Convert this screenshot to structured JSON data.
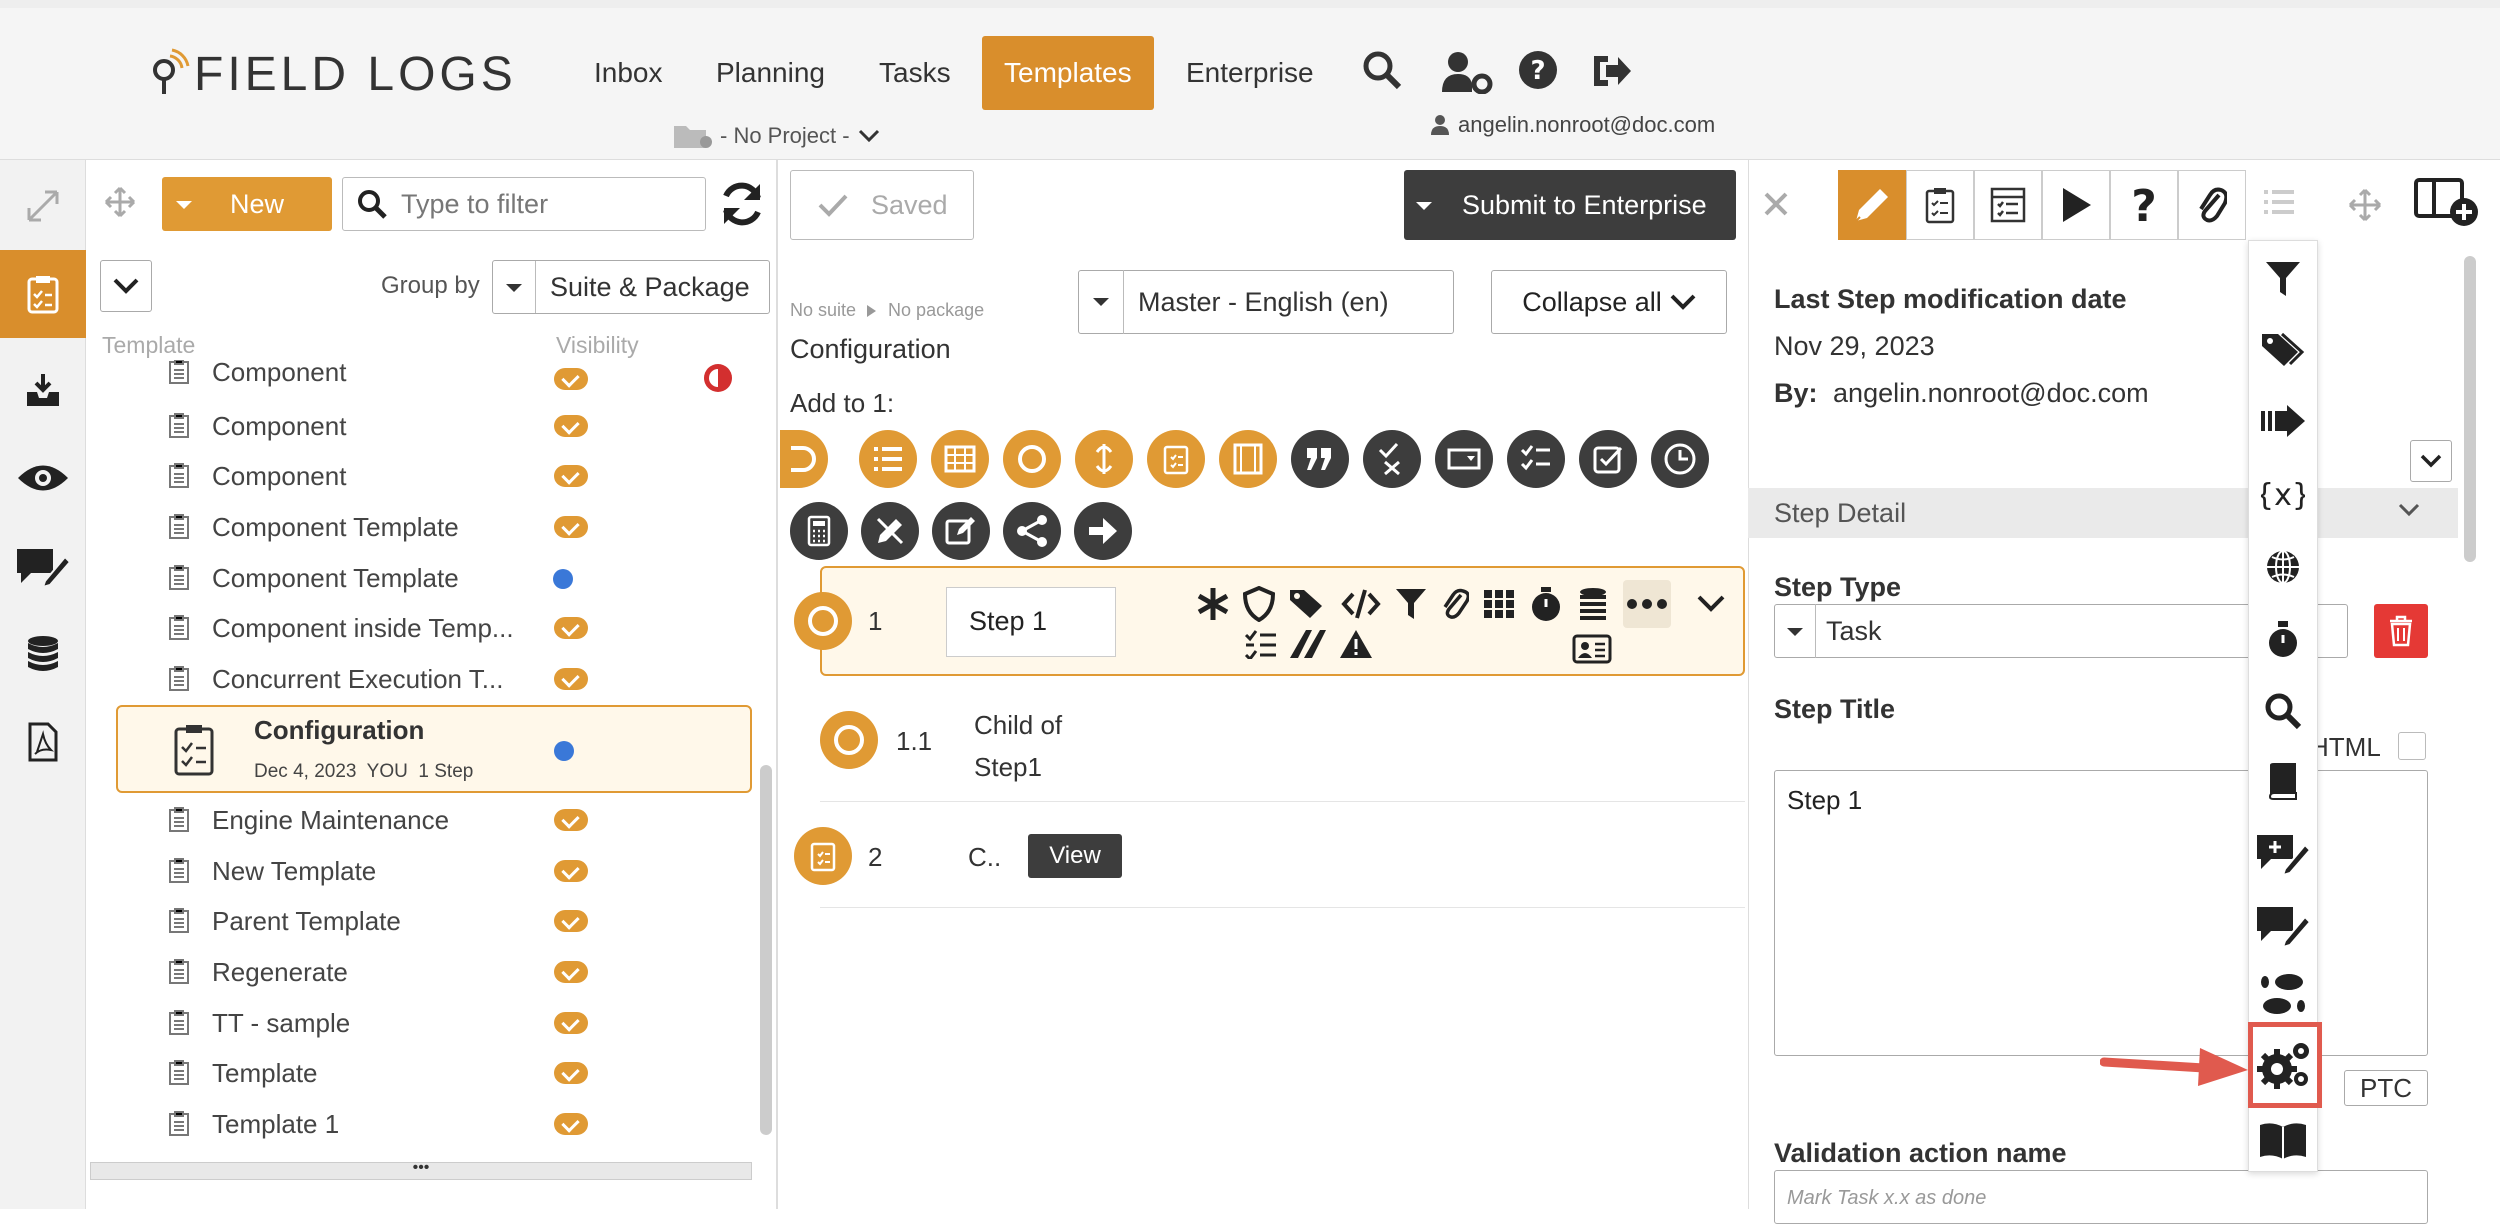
{
  "app": {
    "logo": "FIELD LOGS",
    "user": "angelin.nonroot@doc.com",
    "project": "- No Project -"
  },
  "nav": [
    "Inbox",
    "Planning",
    "Tasks",
    "Templates",
    "Enterprise"
  ],
  "toolbar": {
    "new": "New",
    "filter_placeholder": "Type to filter",
    "saved": "Saved",
    "submit": "Submit to Enterprise"
  },
  "list": {
    "group_by": "Group by",
    "group_value": "Suite & Package",
    "col_template": "Template",
    "col_visibility": "Visibility",
    "items": [
      "Component",
      "Component",
      "Component",
      "Component Template",
      "Component Template",
      "Component inside Temp...",
      "Concurrent Execution T..."
    ],
    "selected": {
      "title": "Configuration",
      "meta": "Dec 4, 2023  YOU  1 Step"
    },
    "items2": [
      "Engine Maintenance",
      "New Template",
      "Parent Template",
      "Regenerate",
      "TT - sample",
      "Template",
      "Template 1"
    ]
  },
  "editor": {
    "breadcrumb_suite": "No suite",
    "breadcrumb_pkg": "No package",
    "name": "Configuration",
    "lang": "Master - English (en)",
    "collapse": "Collapse all",
    "add_to": "Add to 1:",
    "steps": [
      {
        "num": "1",
        "title": "Step 1"
      },
      {
        "num": "1.1",
        "title_a": "Child of",
        "title_b": "Step1"
      },
      {
        "num": "2",
        "title": "C..",
        "view": "View"
      }
    ]
  },
  "detail": {
    "mod_label": "Last Step modification date",
    "mod_date": "Nov 29, 2023",
    "by_label": "By:",
    "by_value": "angelin.nonroot@doc.com",
    "section": "Step Detail",
    "step_type_label": "Step Type",
    "step_type": "Task",
    "step_title_label": "Step Title",
    "html_label": "HTML",
    "step_title_value": "Step 1",
    "ptc": "PTC",
    "validation_label": "Validation action name",
    "validation_placeholder": "Mark Task x.x as done"
  },
  "icons": {
    "search": "search-icon",
    "user_gear": "user-settings-icon",
    "help": "help-icon",
    "logout": "logout-icon",
    "settings": "gears-icon"
  }
}
